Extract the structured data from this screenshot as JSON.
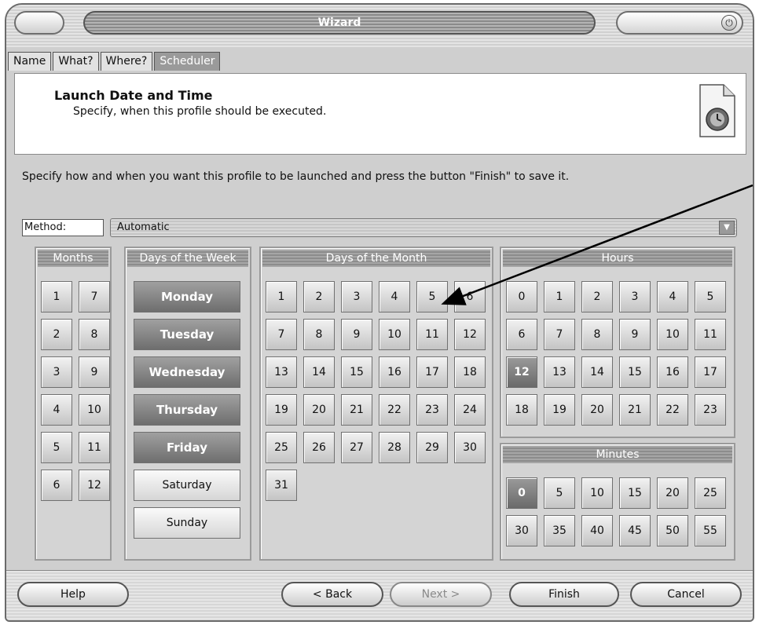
{
  "window": {
    "title": "Wizard"
  },
  "tabs": [
    "Name",
    "What?",
    "Where?",
    "Scheduler"
  ],
  "header": {
    "title": "Launch Date and Time",
    "subtitle": "Specify, when this profile should be executed."
  },
  "intro": "Specify how and when you want this profile to be launched and press the button \"Finish\" to save it.",
  "method": {
    "label": "Method:",
    "value": "Automatic"
  },
  "months": {
    "title": "Months",
    "items": [
      "1",
      "7",
      "2",
      "8",
      "3",
      "9",
      "4",
      "10",
      "5",
      "11",
      "6",
      "12"
    ]
  },
  "days_of_week": {
    "title": "Days of the Week",
    "items": [
      "Monday",
      "Tuesday",
      "Wednesday",
      "Thursday",
      "Friday",
      "Saturday",
      "Sunday"
    ],
    "selected": [
      "Monday",
      "Tuesday",
      "Wednesday",
      "Thursday",
      "Friday"
    ]
  },
  "days_of_month": {
    "title": "Days of the Month",
    "items": [
      "1",
      "2",
      "3",
      "4",
      "5",
      "6",
      "7",
      "8",
      "9",
      "10",
      "11",
      "12",
      "13",
      "14",
      "15",
      "16",
      "17",
      "18",
      "19",
      "20",
      "21",
      "22",
      "23",
      "24",
      "25",
      "26",
      "27",
      "28",
      "29",
      "30",
      "31"
    ]
  },
  "hours": {
    "title": "Hours",
    "items": [
      "0",
      "1",
      "2",
      "3",
      "4",
      "5",
      "6",
      "7",
      "8",
      "9",
      "10",
      "11",
      "12",
      "13",
      "14",
      "15",
      "16",
      "17",
      "18",
      "19",
      "20",
      "21",
      "22",
      "23"
    ],
    "selected": [
      "12"
    ]
  },
  "minutes": {
    "title": "Minutes",
    "items": [
      "0",
      "5",
      "10",
      "15",
      "20",
      "25",
      "30",
      "35",
      "40",
      "45",
      "50",
      "55"
    ],
    "selected": [
      "0"
    ]
  },
  "footer": {
    "help": "Help",
    "back": "< Back",
    "next": "Next >",
    "finish": "Finish",
    "cancel": "Cancel"
  }
}
